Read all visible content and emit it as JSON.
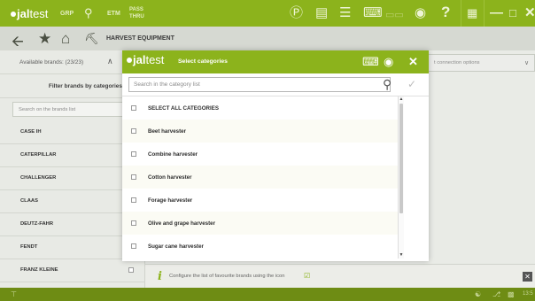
{
  "topbar": {
    "logo_bold": "jal",
    "logo_light": "test",
    "mode_grp": "GRP",
    "mode_etm": "ETM",
    "mode_pass": "PASS",
    "mode_thru": "THRU",
    "icons": [
      "globe-icon",
      "document-icon",
      "list-icon",
      "keyboard-icon",
      "battery-icon",
      "camera-icon",
      "help-icon",
      "grid-icon",
      "minimize-icon",
      "maximize-icon",
      "close-icon"
    ]
  },
  "nav": {
    "breadcrumb": "HARVEST EQUIPMENT",
    "icons": [
      "back-arrow-icon",
      "favourite-star-icon",
      "home-icon",
      "vehicle-icon"
    ]
  },
  "left": {
    "available": "Available brands: (23/23)",
    "filter_label": "Filter brands by categories",
    "search_placeholder": "Search on the brands list",
    "brands": [
      "CASE IH",
      "CATERPILLAR",
      "CHALLENGER",
      "CLAAS",
      "DEUTZ-FAHR",
      "FENDT",
      "FRANZ KLEINE"
    ]
  },
  "right": {
    "connection_placeholder": "t connection options",
    "info_text": "Configure the list of favourite brands using the icon"
  },
  "dialog": {
    "title": "Select categories",
    "search_placeholder": "Search in the category list",
    "items": [
      "SELECT ALL CATEGORIES",
      "Beet harvester",
      "Combine harvester",
      "Cotton harvester",
      "Forage harvester",
      "Olive and grape harvester",
      "Sugar cane harvester"
    ]
  },
  "status": {
    "time": "13:5"
  },
  "colors": {
    "accent": "#8cb31c",
    "accent_dark": "#6e8c14"
  }
}
